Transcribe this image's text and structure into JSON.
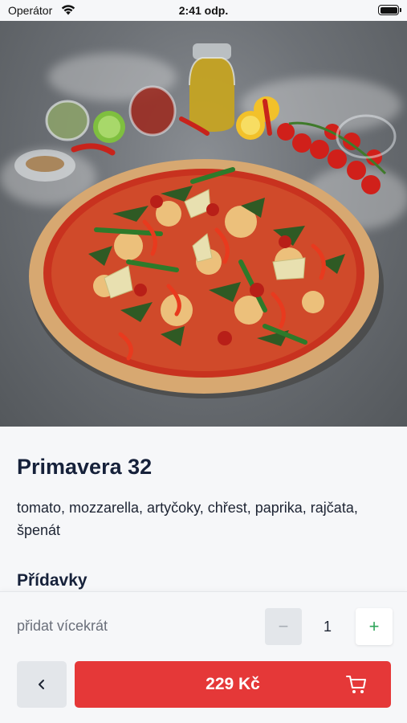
{
  "status_bar": {
    "carrier": "Operátor",
    "time": "2:41 odp."
  },
  "hero": {
    "image_subject": "pizza-photo"
  },
  "product": {
    "title": "Primavera 32",
    "ingredients": "tomato, mozzarella, artyčoky, chřest, paprika, rajčata, špenát",
    "extras_heading": "Přídavky"
  },
  "order": {
    "quantity_label": "přidat vícekrát",
    "minus_symbol": "−",
    "quantity": "1",
    "plus_symbol": "+",
    "price_label": "229 Kč"
  },
  "colors": {
    "accent": "#e53838",
    "plus": "#2fa55a",
    "title": "#16213a"
  },
  "icons": {
    "back": "chevron-left-icon",
    "cart": "cart-icon",
    "wifi": "wifi-icon",
    "battery": "battery-icon"
  }
}
